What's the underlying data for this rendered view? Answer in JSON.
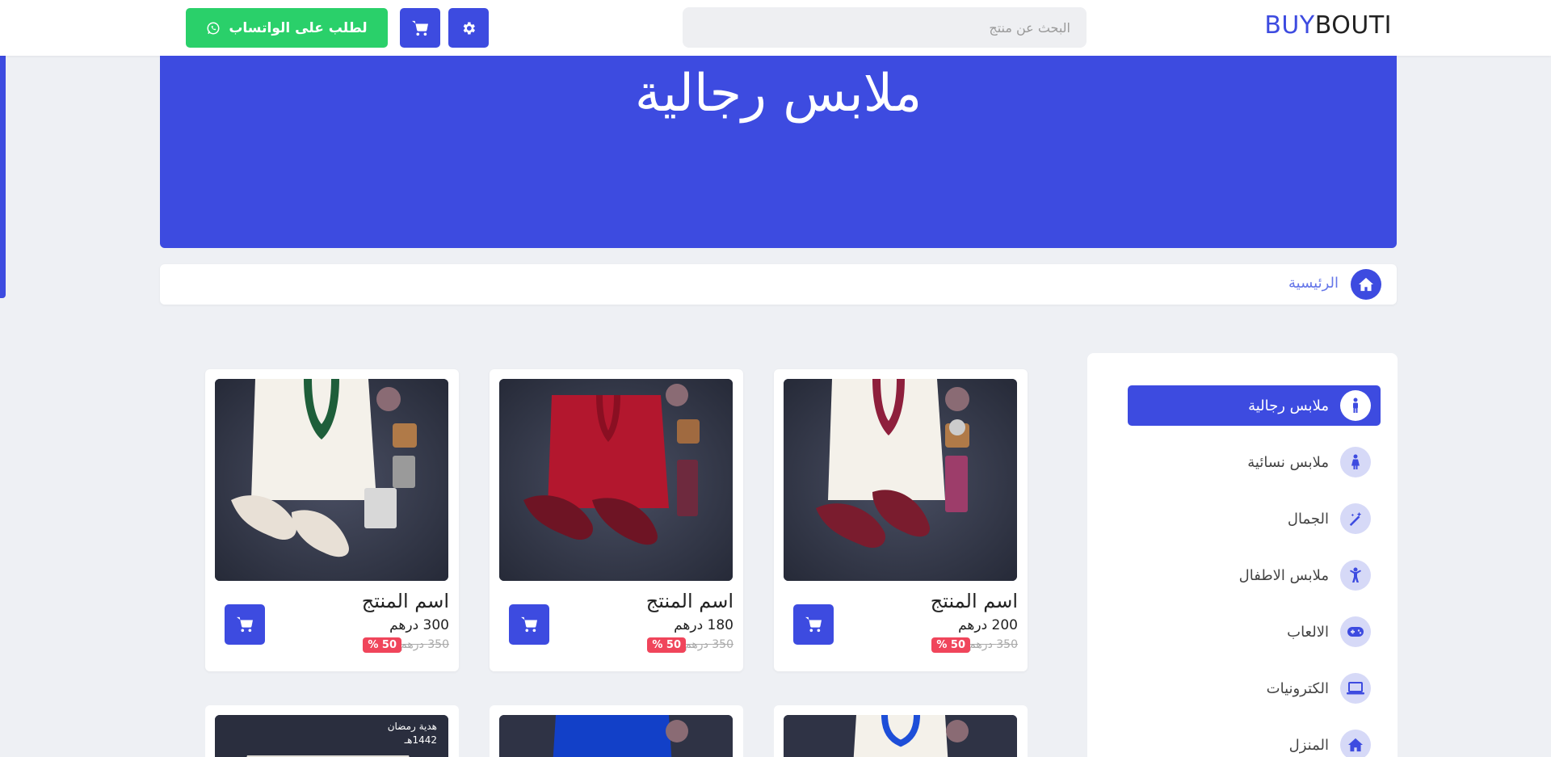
{
  "header": {
    "logo_primary": "BUY",
    "logo_secondary": "BOUTI",
    "search_placeholder": "البحث عن منتج",
    "whatsapp_label": "لطلب على الواتساب"
  },
  "banner": {
    "title": "ملابس رجالية"
  },
  "breadcrumb": {
    "home_label": "الرئيسية"
  },
  "sidebar": {
    "categories": [
      {
        "label": "ملابس رجالية",
        "icon": "male-icon",
        "active": true
      },
      {
        "label": "ملابس نسائية",
        "icon": "female-icon",
        "active": false
      },
      {
        "label": "الجمال",
        "icon": "magic-wand-icon",
        "active": false
      },
      {
        "label": "ملابس الاطفال",
        "icon": "child-icon",
        "active": false
      },
      {
        "label": "الالعاب",
        "icon": "gamepad-icon",
        "active": false
      },
      {
        "label": "الكترونيات",
        "icon": "laptop-icon",
        "active": false
      },
      {
        "label": "المنزل",
        "icon": "home-icon",
        "active": false
      }
    ]
  },
  "products": [
    {
      "name": "اسم المنتج",
      "price": "200 درهم",
      "old_price": "350 درهم",
      "discount": "50 %",
      "garment_color": "#f4f1ea",
      "trim_color": "#8e1f3c",
      "shoe_color": "#7a1c2e"
    },
    {
      "name": "اسم المنتج",
      "price": "180 درهم",
      "old_price": "350 درهم",
      "discount": "50 %",
      "garment_color": "#b3172e",
      "trim_color": "#8a0f22",
      "shoe_color": "#6e1424"
    },
    {
      "name": "اسم المنتج",
      "price": "300 درهم",
      "old_price": "350 درهم",
      "discount": "50 %",
      "garment_color": "#f4f1ea",
      "trim_color": "#1e5e3a",
      "shoe_color": "#e8e0d6"
    }
  ],
  "second_row": {
    "tag_line1": "هدية رمضان",
    "tag_line2": "1442هـ"
  },
  "colors": {
    "accent": "#3d4be0",
    "whatsapp": "#2ad06a",
    "discount": "#f0455b"
  }
}
